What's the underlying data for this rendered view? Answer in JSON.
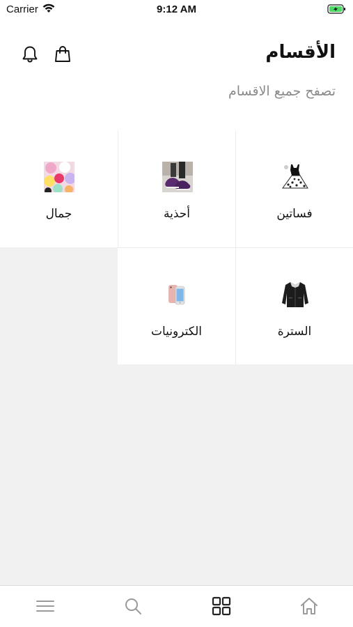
{
  "status_bar": {
    "carrier": "Carrier",
    "time": "9:12 AM",
    "battery_color": "#4cd964"
  },
  "header": {
    "title": "الأقسام",
    "subtitle": "تصفح جميع الاقسام",
    "icons": [
      "bell-icon",
      "shopping-bag-icon"
    ]
  },
  "categories": [
    {
      "label": "فساتين",
      "icon": "dress-thumbnail"
    },
    {
      "label": "أحذية",
      "icon": "shoes-thumbnail"
    },
    {
      "label": "جمال",
      "icon": "beauty-thumbnail"
    },
    {
      "label": "السترة",
      "icon": "jacket-thumbnail"
    },
    {
      "label": "الكترونيات",
      "icon": "phone-thumbnail"
    }
  ],
  "tab_bar": {
    "items": [
      "menu-icon",
      "search-icon",
      "grid-icon",
      "home-icon"
    ],
    "active": "grid-icon",
    "active_color": "#222222",
    "inactive_color": "#9a9a9a"
  },
  "colors": {
    "background_gray": "#f1f1f1",
    "subtitle_gray": "#8a8a8a"
  }
}
